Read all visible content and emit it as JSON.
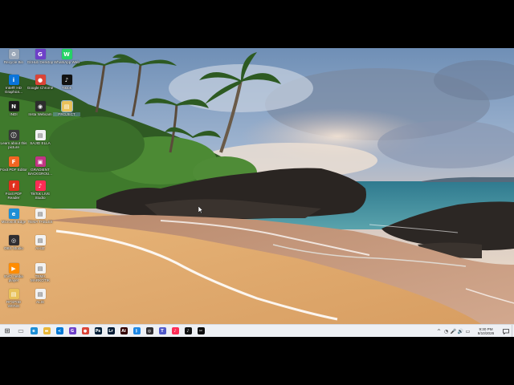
{
  "desktop": {
    "icons": [
      {
        "label": "Recycle Bin",
        "icon": "recycle-bin-icon",
        "color": "#9aa7b8",
        "glyph": "♻"
      },
      {
        "label": "GitHub Desktop",
        "icon": "github-desktop-icon",
        "color": "#6e40c9",
        "glyph": "G"
      },
      {
        "label": "WhatsApp Web",
        "icon": "whatsapp-icon",
        "color": "#25d366",
        "glyph": "W"
      },
      {
        "label": "Intel® HD Graphics...",
        "icon": "intel-graphics-icon",
        "color": "#0a74da",
        "glyph": "i"
      },
      {
        "label": "Google Chrome",
        "icon": "chrome-icon",
        "color": "#db4437",
        "glyph": "●"
      },
      {
        "label": "Tiktok",
        "icon": "tiktok-icon",
        "color": "#111111",
        "glyph": "♪"
      },
      {
        "label": "INDI",
        "icon": "indi-icon",
        "color": "#1c1c1c",
        "glyph": "N"
      },
      {
        "label": "Insta Webcam",
        "icon": "insta-webcam-icon",
        "color": "#2d2d2d",
        "glyph": "◉"
      },
      {
        "label": "PROJECT",
        "icon": "project-folder-icon",
        "color": "#e8c15a",
        "glyph": "▤"
      },
      {
        "label": "Learn about this picture",
        "icon": "learn-picture-icon",
        "color": "#3a3a3a",
        "glyph": "ⓘ"
      },
      {
        "label": "SAJID ELLA",
        "icon": "sajid-ella-file-icon",
        "color": "#f2f2f2",
        "glyph": "▤"
      },
      {
        "label": "Foxit PDF Editor",
        "icon": "foxit-pdf-icon",
        "color": "#f26522",
        "glyph": "F"
      },
      {
        "label": "GRADIENT BACKGROU...",
        "icon": "gradient-background-icon",
        "color": "#c13584",
        "glyph": "▣"
      },
      {
        "label": "Foxit PDF Reader",
        "icon": "foxit-reader-icon",
        "color": "#e0301e",
        "glyph": "f"
      },
      {
        "label": "TikTok LIVE Studio",
        "icon": "tiktok-live-icon",
        "color": "#fe2c55",
        "glyph": "♪"
      },
      {
        "label": "Microsoft Edge",
        "icon": "edge-icon",
        "color": "#1e8fd6",
        "glyph": "e"
      },
      {
        "label": "TEMA TABLES",
        "icon": "tema-tables-file-icon",
        "color": "#f2f2f2",
        "glyph": "▤"
      },
      {
        "label": "OBS Studio",
        "icon": "obs-studio-icon",
        "color": "#302e31",
        "glyph": "◎"
      },
      {
        "label": "AHJZ",
        "icon": "ahjz-file-icon",
        "color": "#f2f2f2",
        "glyph": "▤"
      },
      {
        "label": "EVO media player",
        "icon": "media-player-icon",
        "color": "#ff8c00",
        "glyph": "▶"
      },
      {
        "label": "TEMA MARKOTIK",
        "icon": "tema-markotik-file-icon",
        "color": "#f2f2f2",
        "glyph": "▤"
      },
      {
        "label": "RFSP0D WONG",
        "icon": "rfspod-folder-icon",
        "color": "#e8c15a",
        "glyph": "▤"
      },
      {
        "label": "ALIS",
        "icon": "alis-file-icon",
        "color": "#f2f2f2",
        "glyph": "▤"
      }
    ]
  },
  "taskbar": {
    "apps": [
      {
        "name": "start-button",
        "icon": "windows-start-icon",
        "color": "#444444",
        "glyph": "⊞"
      },
      {
        "name": "task-view-button",
        "icon": "task-view-icon",
        "color": "#666666",
        "glyph": "▭"
      },
      {
        "name": "taskbar-edge",
        "icon": "edge-icon",
        "color": "#1e8fd6",
        "glyph": "e"
      },
      {
        "name": "taskbar-file-explorer",
        "icon": "folder-icon",
        "color": "#e8b73a",
        "glyph": "▬"
      },
      {
        "name": "taskbar-vscode",
        "icon": "vscode-icon",
        "color": "#0078d4",
        "glyph": "≺"
      },
      {
        "name": "taskbar-github-desktop",
        "icon": "github-desktop-icon",
        "color": "#6e40c9",
        "glyph": "G"
      },
      {
        "name": "taskbar-chrome",
        "icon": "chrome-icon",
        "color": "#db4437",
        "glyph": "●"
      },
      {
        "name": "taskbar-photoshop",
        "icon": "photoshop-icon",
        "color": "#001e36",
        "glyph": "Ps"
      },
      {
        "name": "taskbar-lightroom",
        "icon": "lightroom-icon",
        "color": "#001a33",
        "glyph": "Lr"
      },
      {
        "name": "taskbar-illustrator",
        "icon": "illustrator-icon",
        "color": "#330000",
        "glyph": "Ai"
      },
      {
        "name": "taskbar-bluetooth",
        "icon": "bluetooth-icon",
        "color": "#1e88e5",
        "glyph": "ᛒ"
      },
      {
        "name": "taskbar-obs",
        "icon": "obs-studio-icon",
        "color": "#302e31",
        "glyph": "◎"
      },
      {
        "name": "taskbar-teams",
        "icon": "teams-icon",
        "color": "#5059c9",
        "glyph": "T"
      },
      {
        "name": "taskbar-tiktok-live",
        "icon": "tiktok-live-icon",
        "color": "#fe2c55",
        "glyph": "♪"
      },
      {
        "name": "taskbar-tiktok",
        "icon": "tiktok-icon",
        "color": "#111111",
        "glyph": "♪"
      },
      {
        "name": "taskbar-capcut",
        "icon": "capcut-icon",
        "color": "#0c0c0c",
        "glyph": "✂"
      }
    ],
    "tray": {
      "icons": [
        {
          "name": "tray-chevron",
          "icon": "chevron-up-icon",
          "glyph": "^"
        },
        {
          "name": "tray-network",
          "icon": "wifi-icon",
          "glyph": "◔"
        },
        {
          "name": "tray-mic",
          "icon": "microphone-icon",
          "glyph": "🎤"
        },
        {
          "name": "tray-volume",
          "icon": "volume-icon",
          "glyph": "🔊"
        },
        {
          "name": "tray-language",
          "icon": "keyboard-icon",
          "glyph": "▭"
        }
      ],
      "time": "9:30 PM",
      "date": "8/10/2026"
    }
  }
}
